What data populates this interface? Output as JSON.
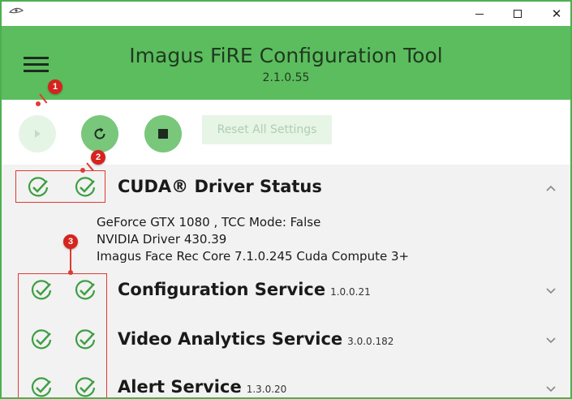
{
  "window": {
    "minimize_glyph": "–",
    "maximize_glyph": "□",
    "close_glyph": "✕"
  },
  "header": {
    "title": "Imagus FiRE Configuration Tool",
    "version": "2.1.0.55"
  },
  "toolbar": {
    "reset_label": "Reset All Settings"
  },
  "sections": {
    "cuda": {
      "title": "CUDA® Driver Status",
      "version": "",
      "expanded": true,
      "details": [
        "GeForce GTX 1080 , TCC Mode: False",
        "NVIDIA Driver 430.39",
        "Imagus Face Rec Core 7.1.0.245 Cuda Compute 3+"
      ]
    },
    "config": {
      "title": "Configuration Service",
      "version": "1.0.0.21",
      "expanded": false
    },
    "video": {
      "title": "Video Analytics Service",
      "version": "3.0.0.182",
      "expanded": false
    },
    "alert": {
      "title": "Alert Service",
      "version": "1.3.0.20",
      "expanded": false
    }
  },
  "annotations": {
    "badge1": "1",
    "badge2": "2",
    "badge3": "3"
  },
  "colors": {
    "accent": "#5cbd5e",
    "check": "#3e9e42",
    "annotation": "#e03b33"
  }
}
